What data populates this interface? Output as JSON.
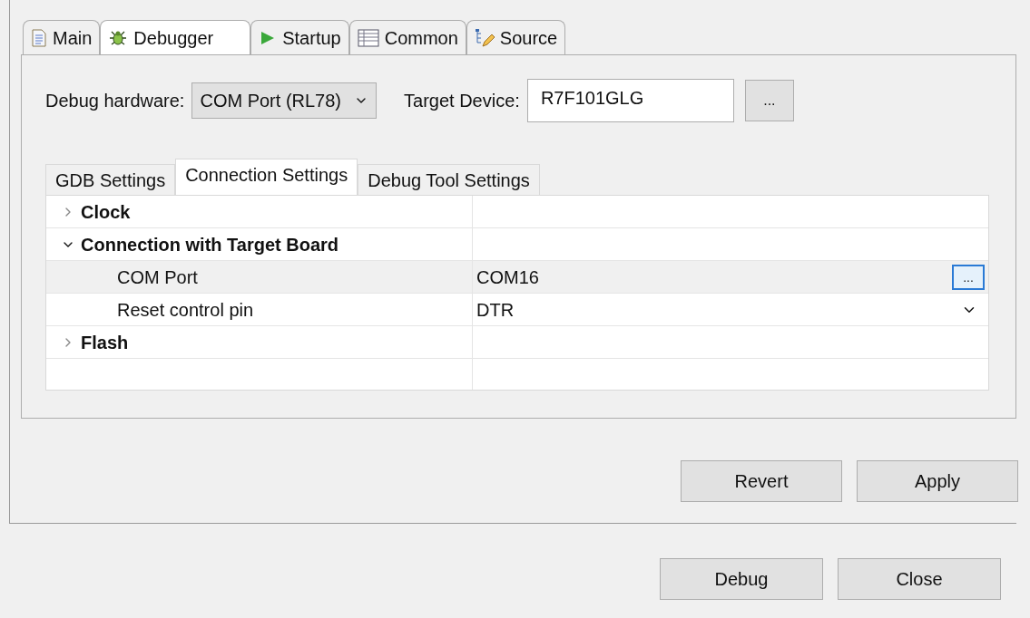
{
  "tabs": [
    {
      "label": "Main",
      "selected": false
    },
    {
      "label": "Debugger",
      "selected": true
    },
    {
      "label": "Startup",
      "selected": false
    },
    {
      "label": "Common",
      "selected": false
    },
    {
      "label": "Source",
      "selected": false
    }
  ],
  "debug_hardware": {
    "label": "Debug hardware:",
    "value": "COM Port (RL78)"
  },
  "target_device": {
    "label": "Target Device:",
    "value": "R7F101GLG",
    "browse_button": "..."
  },
  "settings_tabs": [
    {
      "label": "GDB Settings",
      "selected": false
    },
    {
      "label": "Connection Settings",
      "selected": true
    },
    {
      "label": "Debug Tool Settings",
      "selected": false
    }
  ],
  "properties": [
    {
      "name": "Clock",
      "expanded": false
    },
    {
      "name": "Connection with Target Board",
      "expanded": true,
      "children": [
        {
          "name": "COM Port",
          "value": "COM16",
          "kind": "browse",
          "button": "...",
          "selected": true
        },
        {
          "name": "Reset control pin",
          "value": "DTR",
          "kind": "dropdown",
          "selected": false
        }
      ]
    },
    {
      "name": "Flash",
      "expanded": false
    }
  ],
  "panel_buttons": [
    "Revert",
    "Apply"
  ],
  "dialog_buttons": [
    "Debug",
    "Close"
  ]
}
